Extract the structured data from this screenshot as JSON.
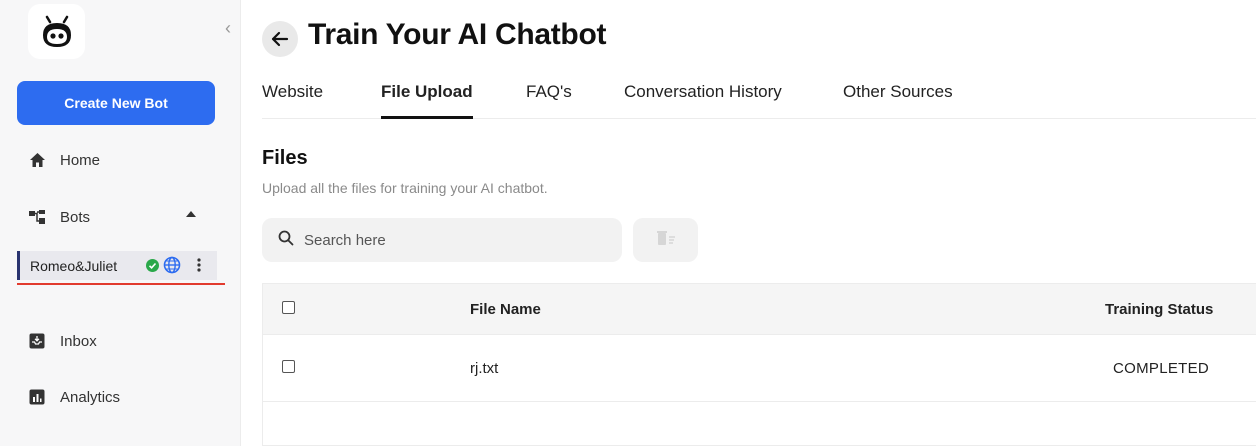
{
  "sidebar": {
    "logo_icon": "robot-logo-icon",
    "collapse_icon": "chevron-left-icon",
    "create_button": "Create New Bot",
    "nav": {
      "home": "Home",
      "bots": "Bots",
      "inbox": "Inbox",
      "analytics": "Analytics"
    },
    "bot": {
      "name": "Romeo&Juliet",
      "status_icon": "check-circle-icon",
      "web_icon": "globe-icon",
      "menu_icon": "kebab-menu-icon"
    },
    "colors": {
      "accent": "#2d6cf0",
      "active_border": "#2a3470",
      "underline": "#e23b2e"
    }
  },
  "header": {
    "title": "Train Your AI Chatbot",
    "back_icon": "arrow-left-icon"
  },
  "tabs": [
    {
      "label": "Website",
      "active": false
    },
    {
      "label": "File Upload",
      "active": true
    },
    {
      "label": "FAQ's",
      "active": false
    },
    {
      "label": "Conversation History",
      "active": false
    },
    {
      "label": "Other Sources",
      "active": false
    }
  ],
  "files": {
    "title": "Files",
    "subtitle": "Upload all the files for training your AI chatbot.",
    "search_placeholder": "Search here",
    "delete_icon": "trash-icon",
    "table": {
      "columns": [
        "File Name",
        "Training Status"
      ],
      "rows": [
        {
          "name": "rj.txt",
          "status": "COMPLETED"
        }
      ]
    }
  }
}
